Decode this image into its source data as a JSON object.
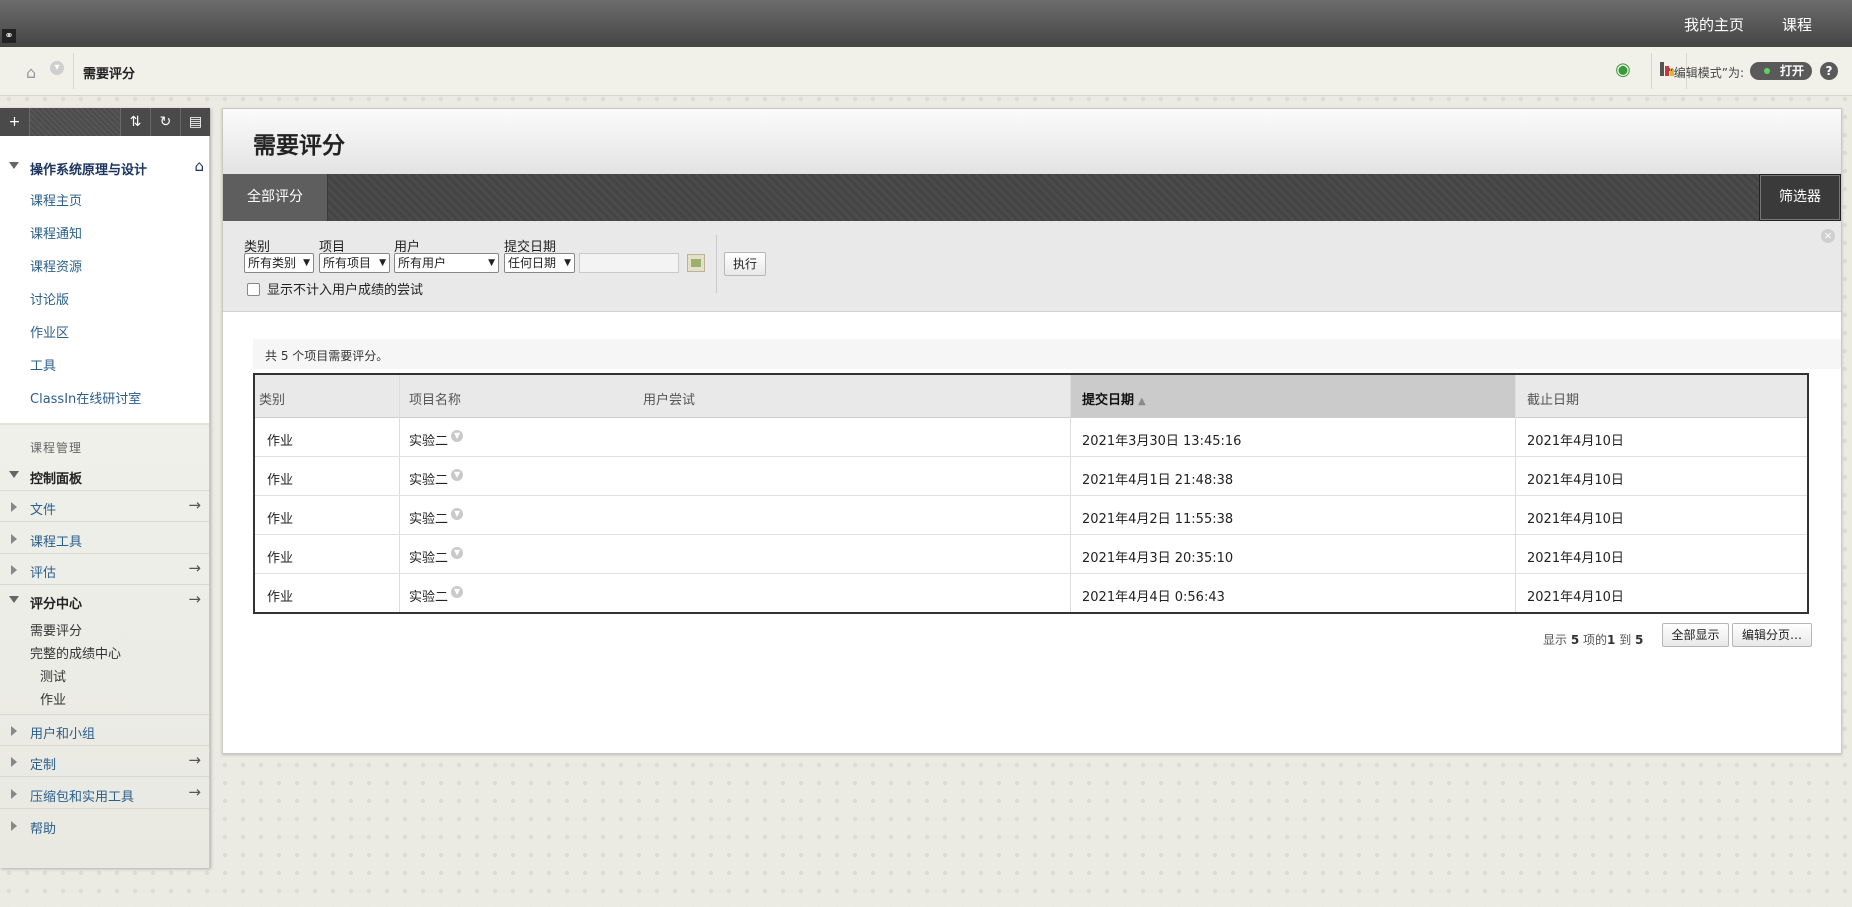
{
  "topnav": {
    "my_home": "我的主页",
    "course": "课程"
  },
  "breadcrumb": {
    "title": "需要评分"
  },
  "header_tools": {
    "edit_mode_label": "“编辑模式”为:",
    "edit_mode_value": "打开",
    "help": "?"
  },
  "sidebar": {
    "course_title": "操作系统原理与设计",
    "links": [
      "课程主页",
      "课程通知",
      "课程资源",
      "讨论版",
      "作业区",
      "工具",
      "ClassIn在线研讨室"
    ],
    "management_title": "课程管理",
    "control_panel": "控制面板",
    "sections": [
      {
        "label": "文件"
      },
      {
        "label": "课程工具"
      },
      {
        "label": "评估"
      },
      {
        "label": "评分中心"
      }
    ],
    "grade_center_items": [
      "需要评分",
      "完整的成绩中心"
    ],
    "grade_center_subitems": [
      "测试",
      "作业"
    ],
    "bottom_sections": [
      {
        "label": "用户和小组"
      },
      {
        "label": "定制"
      },
      {
        "label": "压缩包和实用工具"
      },
      {
        "label": "帮助"
      }
    ]
  },
  "page": {
    "title": "需要评分",
    "tab_all": "全部评分",
    "filter_button": "筛选器"
  },
  "filter": {
    "category_label": "类别",
    "category_value": "所有类别",
    "item_label": "项目",
    "item_value": "所有项目",
    "user_label": "用户",
    "user_value": "所有用户",
    "date_label": "提交日期",
    "date_value": "任何日期",
    "date_input_value": "",
    "execute": "执行",
    "exclude_label": "显示不计入用户成绩的尝试"
  },
  "summary": "共 5 个项目需要评分。",
  "table": {
    "headers": [
      "类别",
      "项目名称",
      "用户尝试",
      "提交日期",
      "截止日期"
    ],
    "sorted_column": "提交日期",
    "rows": [
      {
        "category": "作业",
        "item": "实验二",
        "submitted": "2021年3月30日 13:45:16",
        "due": "2021年4月10日"
      },
      {
        "category": "作业",
        "item": "实验二",
        "submitted": "2021年4月1日 21:48:38",
        "due": "2021年4月10日"
      },
      {
        "category": "作业",
        "item": "实验二",
        "submitted": "2021年4月2日 11:55:38",
        "due": "2021年4月10日"
      },
      {
        "category": "作业",
        "item": "实验二",
        "submitted": "2021年4月3日 20:35:10",
        "due": "2021年4月10日"
      },
      {
        "category": "作业",
        "item": "实验二",
        "submitted": "2021年4月4日 0:56:43",
        "due": "2021年4月10日"
      }
    ]
  },
  "pager": {
    "prefix": "显示 ",
    "total": "5",
    "mid": " 项的",
    "from": "1",
    "to_word": " 到 ",
    "to": "5",
    "show_all": "全部显示",
    "edit_paging": "编辑分页…"
  },
  "colors": {
    "accent_course_tab": "#f3e98b",
    "link": "#2a5e8c",
    "course_title": "#1c3560"
  },
  "icons": {
    "home": "home-icon",
    "eye": "student-preview-icon",
    "palette": "theme-icon",
    "sort": "sort-ascending-icon"
  }
}
